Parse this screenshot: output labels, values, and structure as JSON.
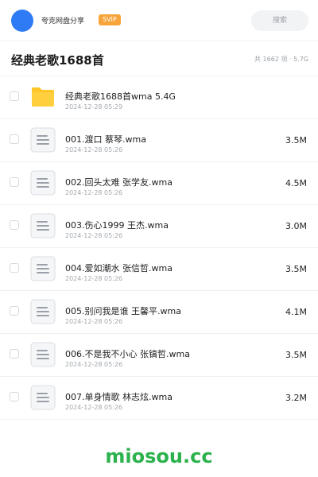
{
  "header": {
    "app_name": "夸克网盘分享",
    "badge": "SVIP",
    "search_placeholder": "搜索"
  },
  "title_bar": {
    "title": "经典老歌1688首",
    "summary": "共 1662 项 · 5.7G"
  },
  "files": [
    {
      "type": "folder",
      "icon": "folder-icon",
      "name": "经典老歌1688首wma 5.4G",
      "date": "2024-12-28 05:29",
      "size": ""
    },
    {
      "type": "file",
      "icon": "document-icon",
      "name": "001.渡口 蔡琴.wma",
      "date": "2024-12-28 05:26",
      "size": "3.5M"
    },
    {
      "type": "file",
      "icon": "document-icon",
      "name": "002.回头太难 张学友.wma",
      "date": "2024-12-28 05:26",
      "size": "4.5M"
    },
    {
      "type": "file",
      "icon": "document-icon",
      "name": "003.伤心1999 王杰.wma",
      "date": "2024-12-28 05:26",
      "size": "3.0M"
    },
    {
      "type": "file",
      "icon": "document-icon",
      "name": "004.爱如潮水 张信哲.wma",
      "date": "2024-12-28 05:26",
      "size": "3.5M"
    },
    {
      "type": "file",
      "icon": "document-icon",
      "name": "005.别问我是谁 王馨平.wma",
      "date": "2024-12-28 05:26",
      "size": "4.1M"
    },
    {
      "type": "file",
      "icon": "document-icon",
      "name": "006.不是我不小心 张镐哲.wma",
      "date": "2024-12-28 05:26",
      "size": "3.5M"
    },
    {
      "type": "file",
      "icon": "document-icon",
      "name": "007.单身情歌 林志炫.wma",
      "date": "2024-12-28 05:26",
      "size": "3.2M"
    }
  ],
  "watermark": "miosou.cc",
  "colors": {
    "accent_blue": "#2f7bf5",
    "badge_orange": "#f7a43a",
    "folder_yellow": "#ffc629",
    "watermark_green": "#2bb24c"
  }
}
